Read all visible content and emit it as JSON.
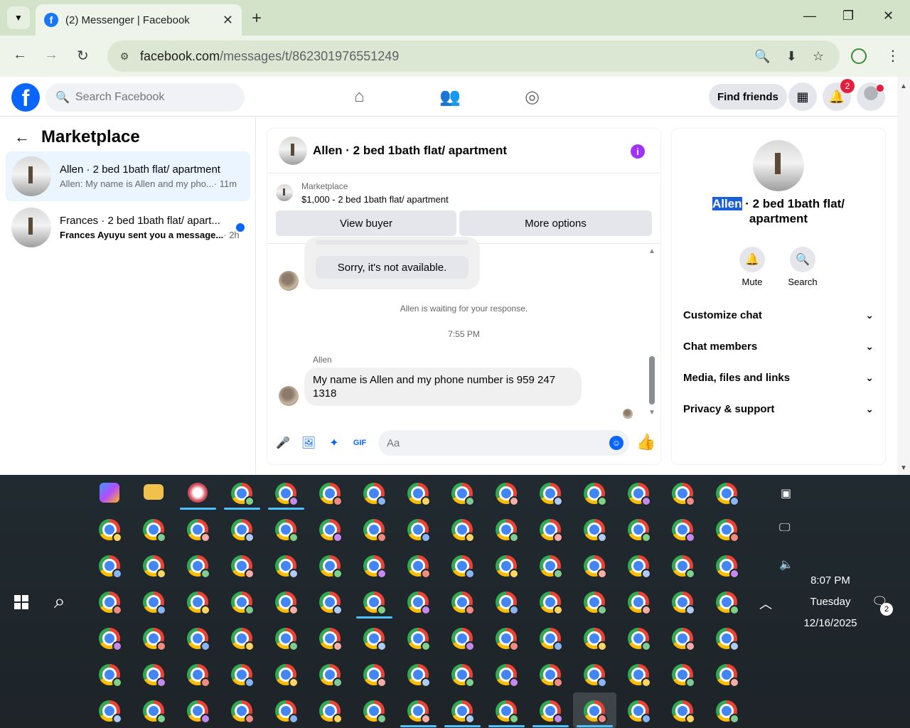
{
  "browser": {
    "tab_title": "(2) Messenger | Facebook",
    "tab_favicon": "f",
    "url_host": "facebook.com",
    "url_path": "/messages/t/862301976551249"
  },
  "facebook": {
    "search_placeholder": "Search Facebook",
    "find_friends": "Find friends",
    "notification_count": "2",
    "brand_color": "#0866ff"
  },
  "sidebar": {
    "title": "Marketplace",
    "chats": [
      {
        "name": "Allen · 2 bed 1bath flat/ apartment",
        "preview": "Allen: My name is Allen and my pho...",
        "time": "· 11m"
      },
      {
        "name": "Frances · 2 bed 1bath flat/ apart...",
        "preview": "Frances Ayuyu sent you a message...",
        "time": "· 2h"
      }
    ]
  },
  "conversation": {
    "title": "Allen · 2 bed 1bath flat/ apartment",
    "marketplace_label": "Marketplace",
    "listing": "$1,000 - 2 bed 1bath flat/ apartment",
    "view_buyer": "View buyer",
    "more_options": "More options",
    "quick_reply": "Sorry, it's not available.",
    "waiting_text": "Allen is waiting for your response.",
    "timestamp": "7:55 PM",
    "sender": "Allen",
    "message": "My name is Allen and my phone number is 959 247 1318",
    "composer_placeholder": "Aa"
  },
  "info_panel": {
    "name_highlight": "Allen",
    "name_rest": " · 2 bed 1bath flat/ apartment",
    "mute_label": "Mute",
    "search_label": "Search",
    "sections": [
      "Customize chat",
      "Chat members",
      "Media, files and links",
      "Privacy & support"
    ]
  },
  "taskbar": {
    "time": "8:07 PM",
    "day": "Tuesday",
    "date": "12/16/2025",
    "notification_count": "2"
  }
}
